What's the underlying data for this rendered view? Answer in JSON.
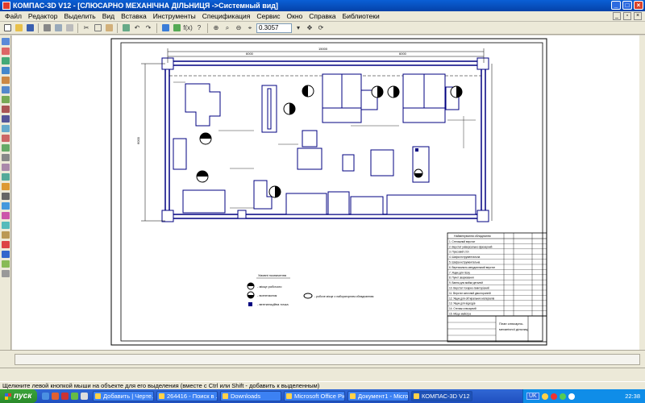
{
  "window": {
    "title": "КОМПАС-3D V12 - [СЛЮСАРНО МЕХАНІЧНА ДІЛЬНИЦЯ ->Системный вид]"
  },
  "menu": [
    "Файл",
    "Редактор",
    "Выделить",
    "Вид",
    "Вставка",
    "Инструменты",
    "Спецификация",
    "Сервис",
    "Окно",
    "Справка",
    "Библиотеки"
  ],
  "toolbar": {
    "zoom_value": "0.3057"
  },
  "drawing": {
    "title_block_name_line1": "План слюсарно-",
    "title_block_name_line2": "механічної дільниці",
    "spec_header_name": "Найменування обладнання",
    "spec_rows": [
      "1. Стелажний верстат",
      "2. Верстат універсально-фрезерний",
      "3. Пресовий стіл",
      "4. Шафа інструментальна",
      "5. Шафа інструментальна",
      "6. Вертикально-свердлильний верстат",
      "7. Ящик для піску",
      "8. Пункт зварювання",
      "9. Ванна для мийки деталей",
      "10. Верстат токарно-гвинторізний",
      "11. Верстат заточний двосторонній",
      "12. Ящик для обтиральних матеріалів",
      "13. Ящик для відходів",
      "14. Стелаж слюсарний",
      "15. Місце майстра"
    ],
    "legend_title": "Умовні позначення",
    "legend_items": [
      "- місце робочого",
      "- вогнегасник",
      "- вентиляційна точка"
    ],
    "legend_extra": "- робоче місце з лабораторним обладнанням"
  },
  "status": {
    "hint": "Щелкните левой кнопкой мыши на объекте для его выделения (вместе с Ctrl или Shift - добавить к выделенным)"
  },
  "taskbar": {
    "start_label": "пуск",
    "tasks": [
      "Добавить | Черте...",
      "264416 - Поиск в ...",
      "Downloads",
      "Microsoft Office Pic...",
      "Документ1 - Micro...",
      "КОМПАС-3D V12 -..."
    ],
    "lang": "UK",
    "clock": "22:38"
  }
}
